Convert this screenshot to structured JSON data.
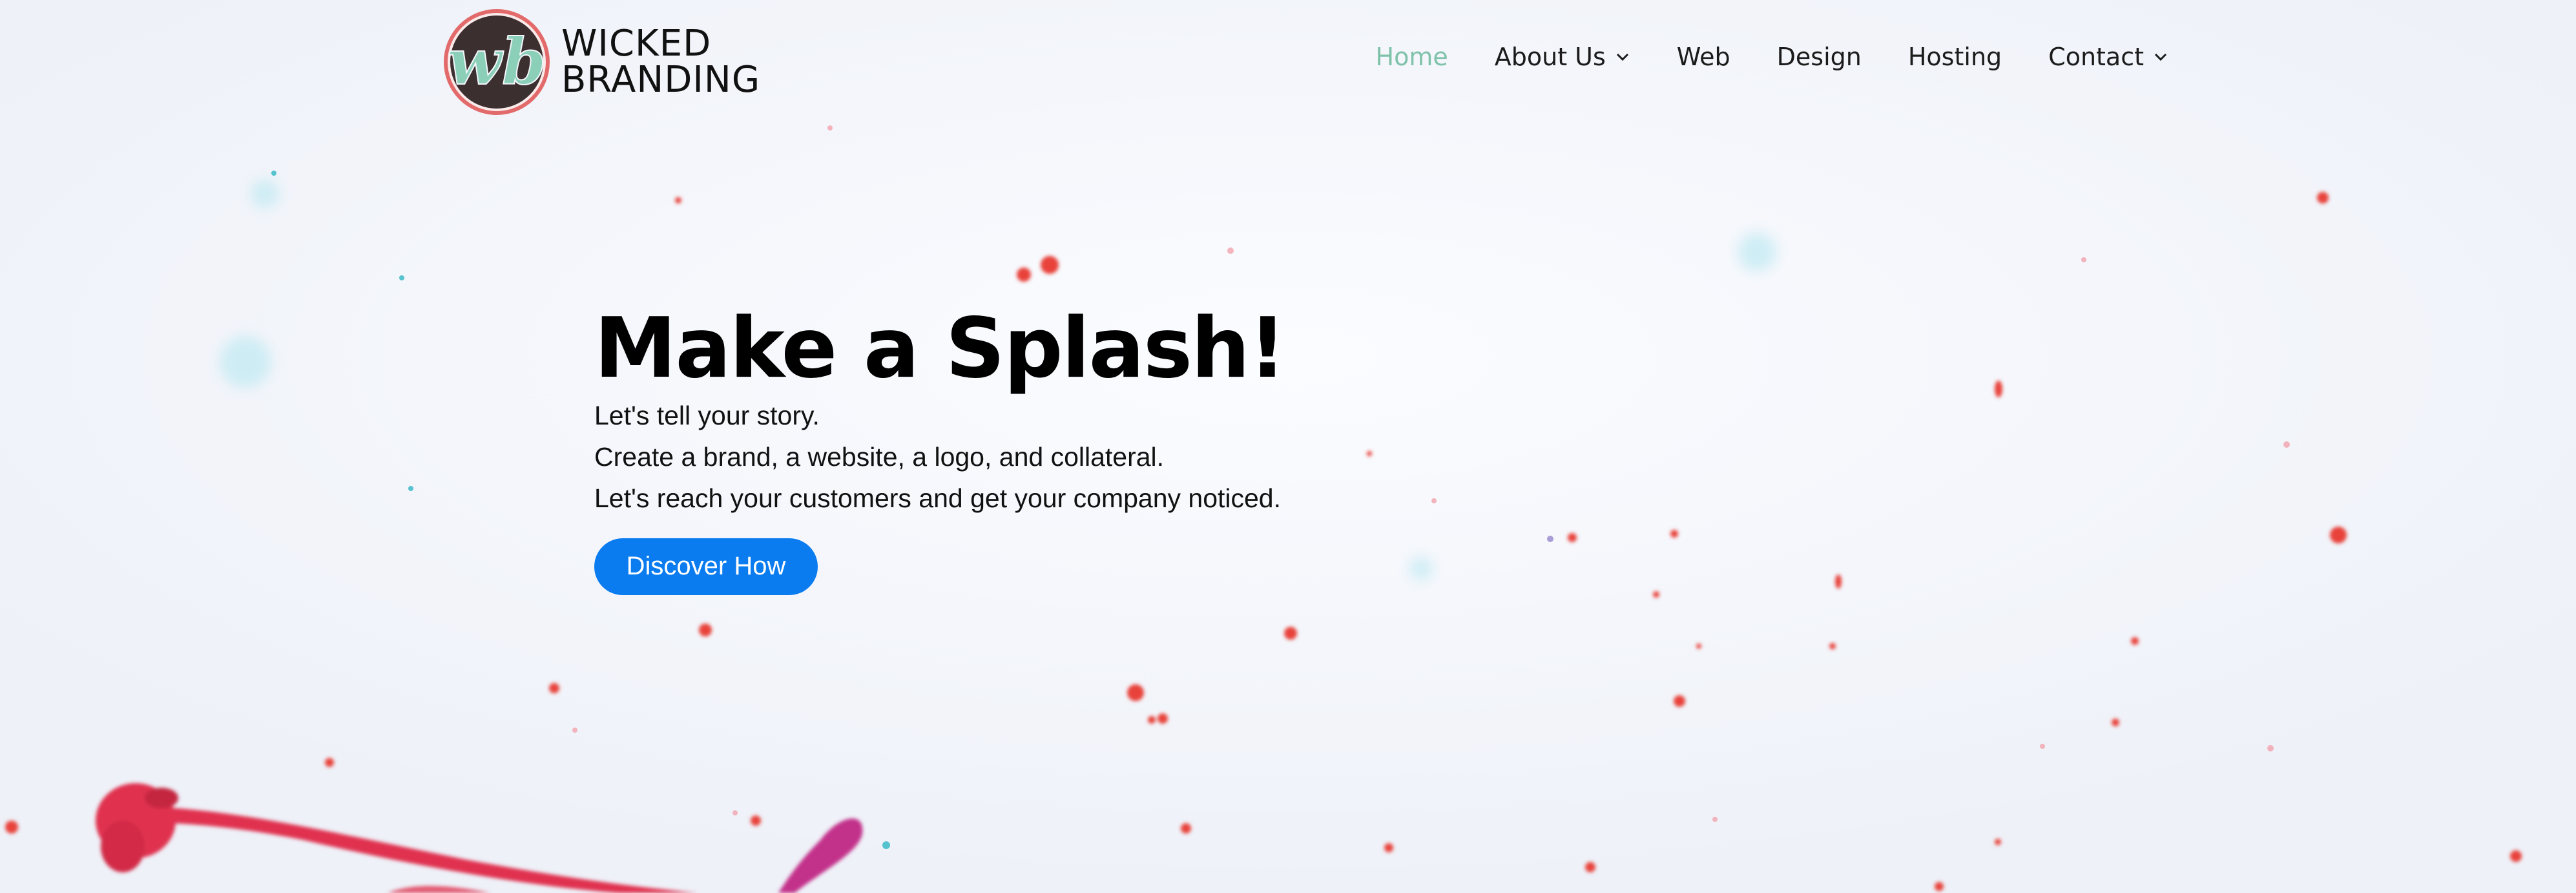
{
  "brand": {
    "logo_line1": "WICKED",
    "logo_line2": "BRANDING",
    "logo_monogram": "wb",
    "logo_colors": {
      "ring": "#e26a6a",
      "fill": "#3b2f2f",
      "monogram": "#8ccfb9"
    }
  },
  "nav": {
    "items": [
      {
        "label": "Home",
        "active": true,
        "has_dropdown": false
      },
      {
        "label": "About Us",
        "active": false,
        "has_dropdown": true
      },
      {
        "label": "Web",
        "active": false,
        "has_dropdown": false
      },
      {
        "label": "Design",
        "active": false,
        "has_dropdown": false
      },
      {
        "label": "Hosting",
        "active": false,
        "has_dropdown": false
      },
      {
        "label": "Contact",
        "active": false,
        "has_dropdown": true
      }
    ],
    "active_color": "#7fc2a9",
    "dropdown_icon": "chevron-down-icon"
  },
  "hero": {
    "heading": "Make a Splash!",
    "lines": [
      "Let's tell your story.",
      "Create a brand, a website, a logo, and collateral.",
      "Let's reach your customers and get your company noticed."
    ],
    "cta_label": "Discover How",
    "cta_color": "#0a7cf0"
  },
  "background": {
    "description_color": "#f4f6fb",
    "splash_colors": [
      "#e0334f",
      "#e8423a",
      "#c2308a",
      "#2fb7c4"
    ]
  }
}
